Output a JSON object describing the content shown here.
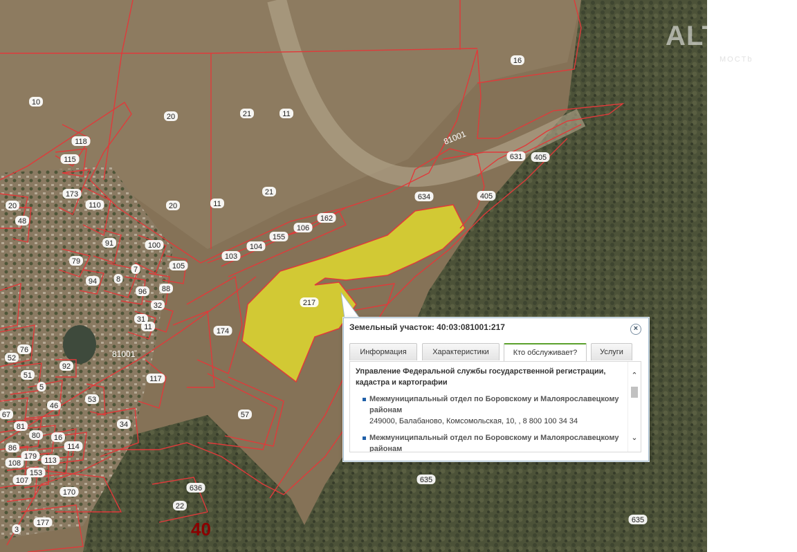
{
  "map": {
    "parcel_labels": [
      {
        "text": "10"
      },
      {
        "text": "20"
      },
      {
        "text": "21"
      },
      {
        "text": "11"
      },
      {
        "text": "21"
      },
      {
        "text": "20"
      },
      {
        "text": "11"
      },
      {
        "text": "16"
      },
      {
        "text": "118"
      },
      {
        "text": "115"
      },
      {
        "text": "173"
      },
      {
        "text": "110"
      },
      {
        "text": "20"
      },
      {
        "text": "48"
      },
      {
        "text": "103"
      },
      {
        "text": "104"
      },
      {
        "text": "155"
      },
      {
        "text": "106"
      },
      {
        "text": "162"
      },
      {
        "text": "634"
      },
      {
        "text": "405"
      },
      {
        "text": "631"
      },
      {
        "text": "405"
      },
      {
        "text": "217"
      },
      {
        "text": "174"
      },
      {
        "text": "91"
      },
      {
        "text": "100"
      },
      {
        "text": "79"
      },
      {
        "text": "7"
      },
      {
        "text": "105"
      },
      {
        "text": "94"
      },
      {
        "text": "8"
      },
      {
        "text": "96"
      },
      {
        "text": "88"
      },
      {
        "text": "32"
      },
      {
        "text": "31"
      },
      {
        "text": "11"
      },
      {
        "text": "76"
      },
      {
        "text": "52"
      },
      {
        "text": "51"
      },
      {
        "text": "5"
      },
      {
        "text": "92"
      },
      {
        "text": "117"
      },
      {
        "text": "53"
      },
      {
        "text": "46"
      },
      {
        "text": "67"
      },
      {
        "text": "81"
      },
      {
        "text": "80"
      },
      {
        "text": "16"
      },
      {
        "text": "86"
      },
      {
        "text": "179"
      },
      {
        "text": "114"
      },
      {
        "text": "108"
      },
      {
        "text": "113"
      },
      {
        "text": "107"
      },
      {
        "text": "153"
      },
      {
        "text": "34"
      },
      {
        "text": "57"
      },
      {
        "text": "170"
      },
      {
        "text": "636"
      },
      {
        "text": "22"
      },
      {
        "text": "177"
      },
      {
        "text": "635"
      },
      {
        "text": "635"
      },
      {
        "text": "3"
      }
    ],
    "quarter_labels": [
      "81001",
      "81001"
    ],
    "district_label": "40",
    "colors": {
      "boundary": "#e03a3a",
      "selected_fill": "#e8e22a",
      "field": "#8c7a5e",
      "forest": "#4a5136"
    }
  },
  "watermark": {
    "brand": "ALT",
    "sub": "MOCTb"
  },
  "popup": {
    "title": "Земельный участок: 40:03:081001:217",
    "close_label": "×",
    "tabs": [
      "Информация",
      "Характеристики",
      "Кто обслуживает?",
      "Услуги"
    ],
    "active_tab": "Кто обслуживает?",
    "organization": "Управление Федеральной службы государственной регистрации, кадастра и картографии",
    "items": [
      {
        "name": "Межмуниципальный отдел по Боровскому и Малоярославецкому районам",
        "address": "249000, Балабаново, Комсомольская, 10, , 8 800 100 34 34"
      },
      {
        "name": "Межмуниципальный отдел по Боровскому и Малоярославецкому районам",
        "address": ""
      }
    ],
    "scroll_up": "⌃",
    "scroll_down": "⌄"
  }
}
